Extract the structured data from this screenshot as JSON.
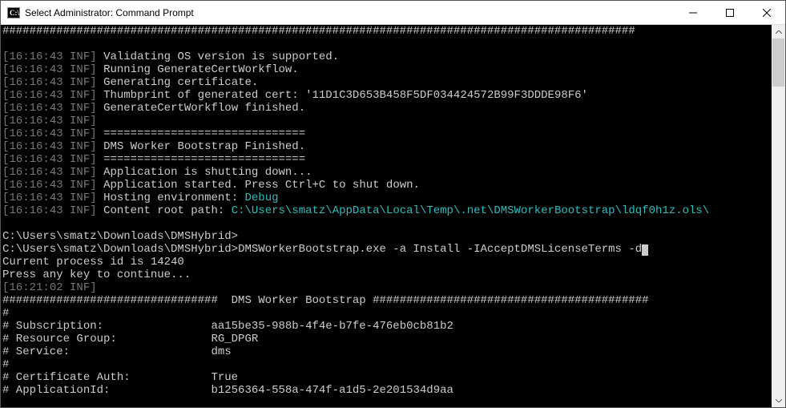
{
  "window": {
    "title": "Select Administrator: Command Prompt"
  },
  "console": {
    "hash_top_row": "##############################################################################################",
    "ts": "16:16:43",
    "lvl": "INF",
    "lines": {
      "l1": "Validating OS version is supported.",
      "l2": "Running GenerateCertWorkflow.",
      "l3": "Generating certificate.",
      "l4": "Thumbprint of generated cert: '11D1C3D653B458F5DF034424572B99F3DDDE98F6'",
      "l5": "GenerateCertWorkflow finished.",
      "sep_eq": "==============================",
      "l6": "DMS Worker Bootstrap Finished.",
      "l7": "Application is shutting down...",
      "l8": "Application started. Press Ctrl+C to shut down.",
      "l9a": "Hosting environment: ",
      "l9b": "Debug",
      "l10a": "Content root path: ",
      "l10b": "C:\\Users\\smatz\\AppData\\Local\\Temp\\.net\\DMSWorkerBootstrap\\ldqf0h1z.ols\\"
    },
    "prompt1": "C:\\Users\\smatz\\Downloads\\DMSHybrid>",
    "prompt2": "C:\\Users\\smatz\\Downloads\\DMSHybrid>",
    "cmd2": "DMSWorkerBootstrap.exe -a Install -IAcceptDMSLicenseTerms -d",
    "proc_line": "Current process id is 14240",
    "press_line": "Press any key to continue...",
    "ts2": "16:21:02",
    "hash_left": "################################",
    "hash_title": "DMS Worker Bootstrap",
    "hash_right": "#########################################",
    "kv": {
      "subscription_label": "# Subscription:",
      "subscription_value": "aa15be35-988b-4f4e-b7fe-476eb0cb81b2",
      "rg_label": "# Resource Group:",
      "rg_value": "RG_DPGR",
      "service_label": "# Service:",
      "service_value": "dms",
      "cert_label": "# Certificate Auth:",
      "cert_value": "True",
      "appid_label": "# ApplicationId:",
      "appid_value": "b1256364-558a-474f-a1d5-2e201534d9aa"
    },
    "hash_only": "#"
  }
}
